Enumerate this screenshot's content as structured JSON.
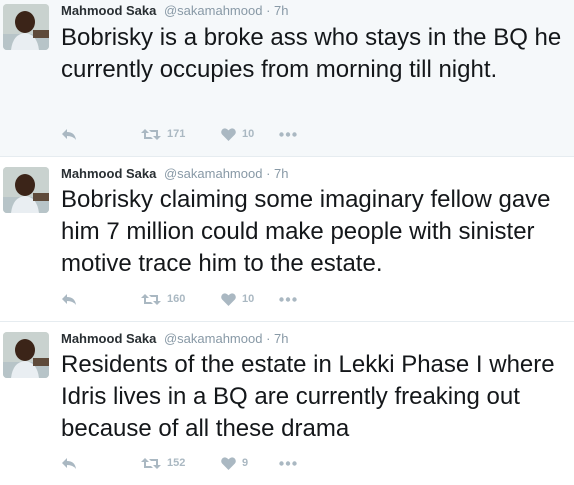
{
  "tweets": [
    {
      "author": {
        "name": "Mahmood Saka",
        "handle": "@sakamahmood"
      },
      "separator": "·",
      "time": "7h",
      "text": "Bobrisky is a broke ass who stays in the BQ he currently occupies from morning till night.",
      "retweets": "171",
      "likes": "10"
    },
    {
      "author": {
        "name": "Mahmood Saka",
        "handle": "@sakamahmood"
      },
      "separator": "·",
      "time": "7h",
      "text": "Bobrisky claiming some imaginary fellow gave him 7 million could make people with sinister motive trace him to the estate.",
      "retweets": "160",
      "likes": "10"
    },
    {
      "author": {
        "name": "Mahmood Saka",
        "handle": "@sakamahmood"
      },
      "separator": "·",
      "time": "7h",
      "text": "Residents of the estate in Lekki Phase I where Idris lives in a BQ are currently freaking out because of all these drama",
      "retweets": "152",
      "likes": "9"
    }
  ],
  "icons": {
    "reply": "reply-icon",
    "retweet": "retweet-icon",
    "like": "heart-icon",
    "more": "more-dots-icon"
  },
  "colors": {
    "action_gray": "#aab8c2",
    "secondary_text": "#8899a6",
    "highlight_bg": "#f5f8fa"
  }
}
